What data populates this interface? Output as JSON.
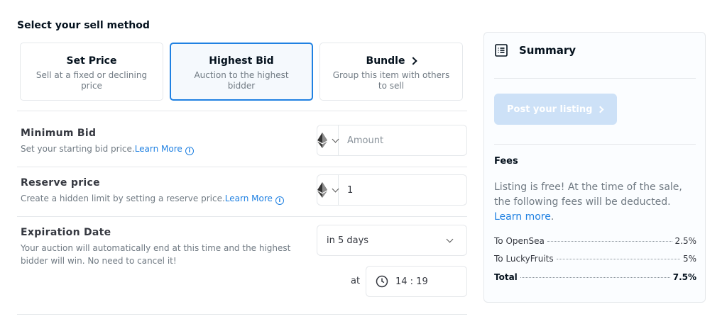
{
  "heading": "Select your sell method",
  "methods": [
    {
      "title": "Set Price",
      "desc": "Sell at a fixed or declining price"
    },
    {
      "title": "Highest Bid",
      "desc": "Auction to the highest bidder"
    },
    {
      "title": "Bundle",
      "desc": "Group this item with others to sell"
    }
  ],
  "minimum_bid": {
    "title": "Minimum Bid",
    "desc": "Set your starting bid price.",
    "link": "Learn More",
    "currency_icon": "ethereum-icon",
    "placeholder": "Amount",
    "value": ""
  },
  "reserve_price": {
    "title": "Reserve price",
    "desc": "Create a hidden limit by setting a reserve price.",
    "link": "Learn More",
    "currency_icon": "ethereum-icon",
    "value": "1"
  },
  "expiration": {
    "title": "Expiration Date",
    "desc": "Your auction will automatically end at this time and the highest bidder will win. No need to cancel it!",
    "selected": "in 5 days",
    "at_label": "at",
    "time": "14 : 19"
  },
  "summary": {
    "title": "Summary",
    "post_button": "Post your listing",
    "fees_title": "Fees",
    "fees_text": "Listing is free! At the time of the sale, the following fees will be deducted.",
    "fees_link": "Learn more",
    "fees": [
      {
        "label": "To OpenSea",
        "value": "2.5%"
      },
      {
        "label": "To LuckyFruits",
        "value": "5%"
      },
      {
        "label": "Total",
        "value": "7.5%"
      }
    ]
  },
  "colors": {
    "accent": "#2081e2",
    "post_button_disabled": "#cde1f7"
  }
}
